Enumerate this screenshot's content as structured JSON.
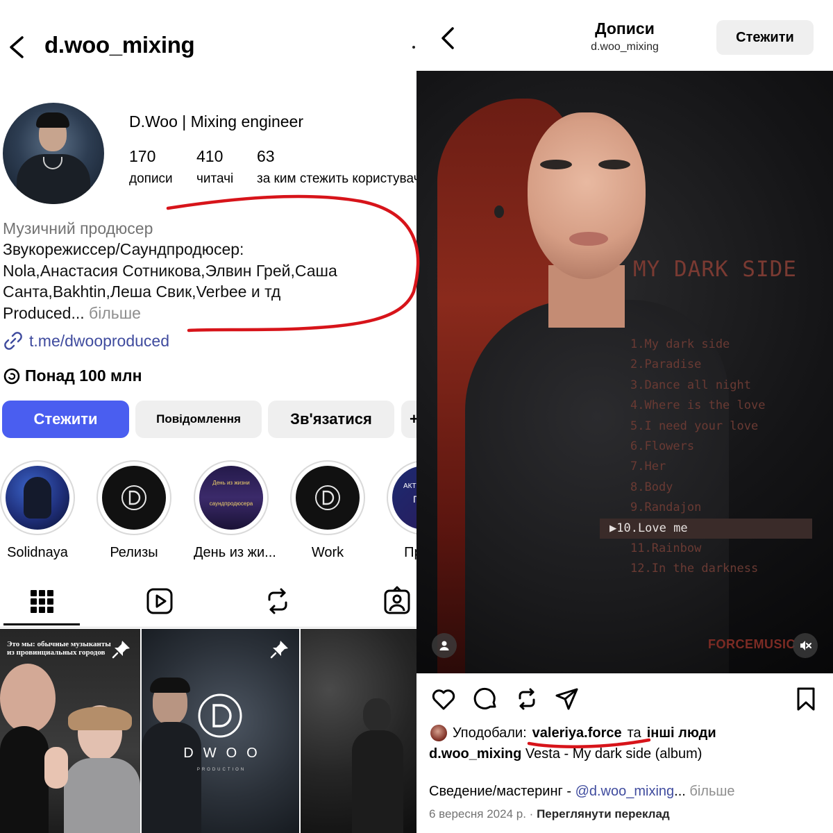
{
  "profile": {
    "username": "d.woo_mixing",
    "full_name": "D.Woo | Mixing engineer",
    "stats": [
      {
        "value": "170",
        "label": "дописи"
      },
      {
        "value": "410",
        "label": "читачі"
      },
      {
        "value": "63",
        "label": "за ким стежить користувач"
      }
    ],
    "category": "Музичний продюсер",
    "bio_lines": [
      "Звукорежиссер/Саундпродюсер:",
      "Nola,Анастасия Сотникова,Элвин Грей,Саша",
      "Санта,Bakhtin,Леша Свик,Verbee и тд",
      "Produced..."
    ],
    "bio_more": "більше",
    "link": "t.me/dwooproduced",
    "threads": "Понад 100 млн",
    "buttons": {
      "follow": "Стежити",
      "message": "Повідомлення",
      "contact": "Зв'язатися",
      "add": "+"
    },
    "highlights": [
      {
        "label": "Solidnaya"
      },
      {
        "label": "Релизы"
      },
      {
        "label": "День из жи...",
        "cover_text": [
          "День из жизни",
          "саундпродюсера"
        ]
      },
      {
        "label": "Work"
      },
      {
        "label": "Прайс",
        "cover_text": [
          "АКТУ",
          "П"
        ]
      }
    ],
    "grid": [
      {
        "caption": [
          "Это мы: обычные музыканты",
          "из провинциальных городов"
        ]
      },
      {
        "logo_text": "DWOO",
        "logo_sub": "PRODUCTION"
      },
      {}
    ]
  },
  "post": {
    "header_title": "Дописи",
    "header_sub": "d.woo_mixing",
    "follow": "Стежити",
    "cover": {
      "album_title": "MY DARK SIDE",
      "tracks": [
        "1.My dark side",
        "2.Paradise",
        "3.Dance all night",
        "4.Where is the love",
        "5.I need your love",
        "6.Flowers",
        "7.Her",
        "8.Body",
        "9.Randajon",
        "▶10.Love me",
        "11.Rainbow",
        "12.In the darkness"
      ],
      "active_track_index": 9,
      "brand": "FORCEMUSIC"
    },
    "liked_by_prefix": "Уподобали:",
    "liked_by_user": "valeriya.force",
    "liked_by_and": "та",
    "liked_by_others": "інші люди",
    "caption_user": "d.woo_mixing",
    "caption_text": "Vesta - My dark side (album)",
    "credits_prefix": "Сведение/мастеринг -",
    "credits_mention": "@d.woo_mixing",
    "credits_ellipsis": "...",
    "more": "більше",
    "date": "6 вересня 2024 р.",
    "separator": "·",
    "translate": "Переглянути переклад"
  },
  "colors": {
    "accent_blue": "#4a5ef0",
    "link_blue": "#3f4b9e",
    "annotation_red": "#d7141a"
  }
}
